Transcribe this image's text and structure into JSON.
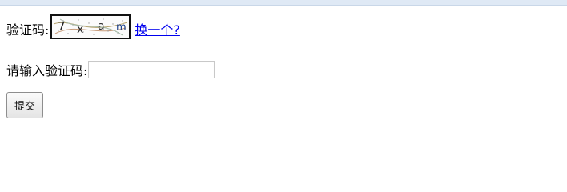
{
  "form": {
    "captcha_label": "验证码:",
    "captcha_text": "7 x a m",
    "refresh_link": "换一个?",
    "input_label": "请输入验证码:",
    "input_value": "",
    "input_placeholder": "",
    "submit_label": "提交"
  }
}
